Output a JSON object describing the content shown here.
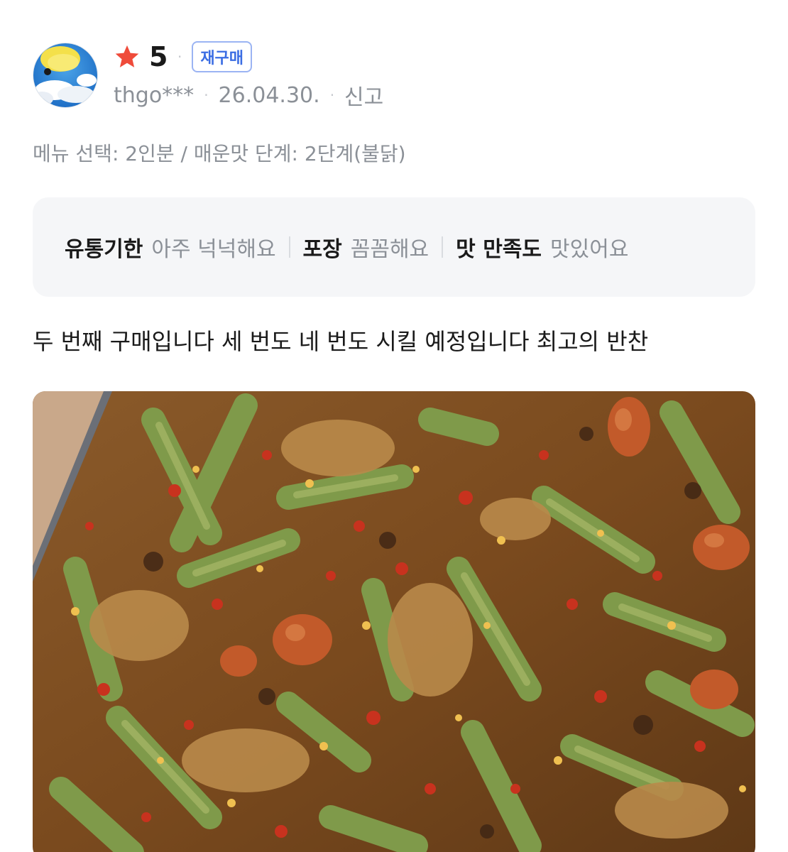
{
  "review": {
    "rating": "5",
    "badge": "재구매",
    "user": "thgo***",
    "date": "26.04.30.",
    "report_label": "신고",
    "dot": "·",
    "option": "메뉴 선택: 2인분 / 매운맛 단계: 2단계(불닭)",
    "summary": [
      {
        "key": "유통기한",
        "value": "아주 넉넉해요"
      },
      {
        "key": "포장",
        "value": "꼼꼼해요"
      },
      {
        "key": "맛 만족도",
        "value": "맛있어요"
      }
    ],
    "text": "두 번째 구매입니다 세 번도 네 번도 시킬 예정입니다 최고의 반찬"
  },
  "colors": {
    "star": "#ef4b3a",
    "badge_border": "#9bb4f3",
    "badge_text": "#3b6de3",
    "muted_text": "#8b9097",
    "summary_bg": "#f5f6f8"
  },
  "icons": {
    "star": "star-icon",
    "avatar": "avatar-image",
    "photo": "review-photo"
  }
}
